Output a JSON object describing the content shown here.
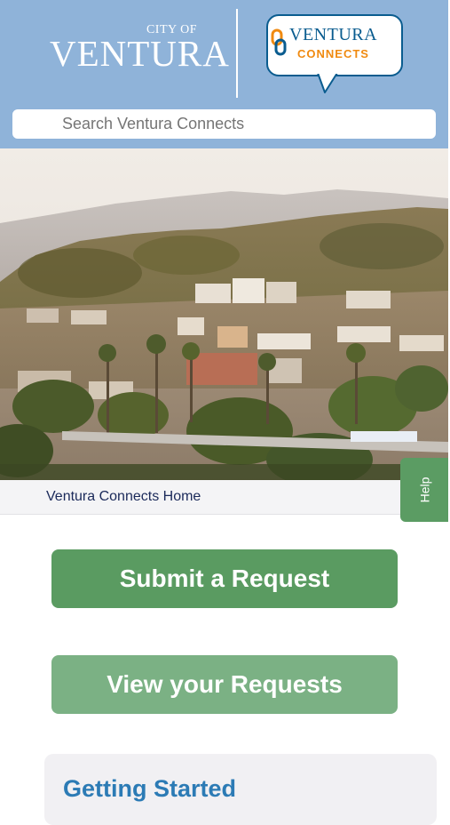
{
  "header": {
    "city_logo": {
      "small": "CITY OF",
      "name": "VENTURA"
    },
    "connects_logo": {
      "word": "VENTURA",
      "sub": "CONNECTS"
    },
    "colors": {
      "background": "#8fb3d9",
      "logo_blue": "#0a5c8f",
      "logo_orange": "#f08a10"
    }
  },
  "search": {
    "placeholder": "Search Ventura Connects"
  },
  "hero": {
    "image": "ventura-hillside-city-photo"
  },
  "breadcrumb": {
    "label": "Ventura Connects Home"
  },
  "help_tab": {
    "label": "Help"
  },
  "actions": {
    "submit_label": "Submit a Request",
    "view_label": "View your Requests"
  },
  "getting_started": {
    "title": "Getting Started"
  },
  "colors": {
    "accent_green": "#5a9b61",
    "accent_green_light": "#7bb184",
    "link_blue": "#2c7bb5"
  }
}
